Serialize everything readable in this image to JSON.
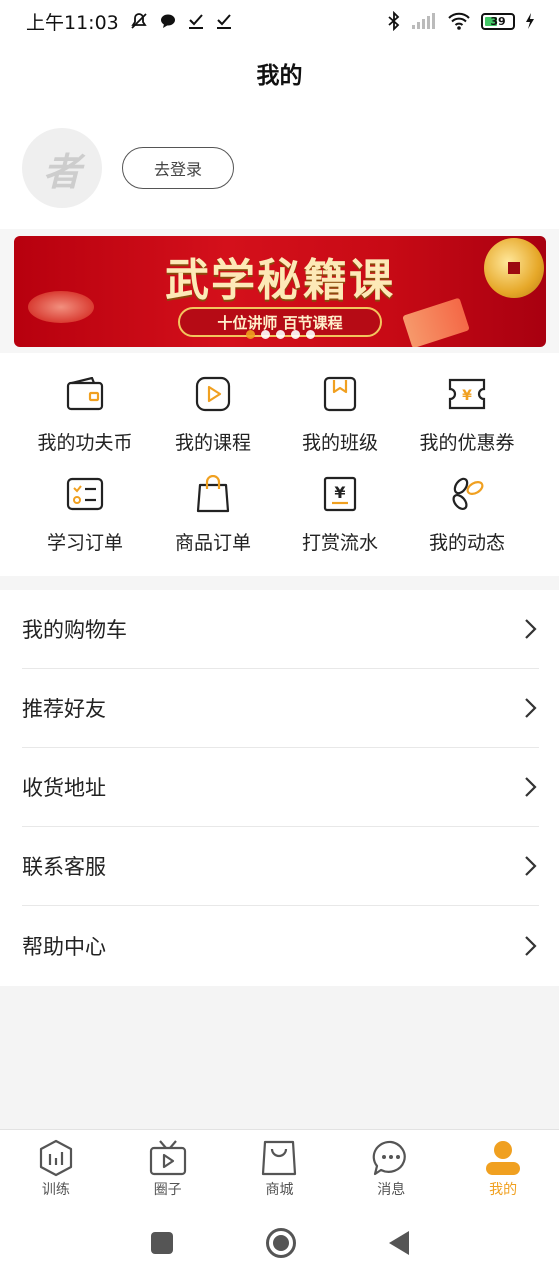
{
  "status_bar": {
    "time": "上午11:03",
    "battery": "39"
  },
  "header": {
    "title": "我的"
  },
  "profile": {
    "avatar_char": "者",
    "login_label": "去登录"
  },
  "banner": {
    "title": "武学秘籍课",
    "subtitle": "十位讲师 百节课程"
  },
  "grid": [
    {
      "label": "我的功夫币",
      "icon": "wallet-icon"
    },
    {
      "label": "我的课程",
      "icon": "play-course-icon"
    },
    {
      "label": "我的班级",
      "icon": "bookmark-class-icon"
    },
    {
      "label": "我的优惠券",
      "icon": "coupon-icon"
    },
    {
      "label": "学习订单",
      "icon": "study-order-icon"
    },
    {
      "label": "商品订单",
      "icon": "shopping-bag-icon"
    },
    {
      "label": "打赏流水",
      "icon": "reward-record-icon"
    },
    {
      "label": "我的动态",
      "icon": "feeds-icon"
    }
  ],
  "menu": [
    {
      "label": "我的购物车"
    },
    {
      "label": "推荐好友"
    },
    {
      "label": "收货地址"
    },
    {
      "label": "联系客服"
    },
    {
      "label": "帮助中心"
    }
  ],
  "tabs": [
    {
      "label": "训练",
      "icon": "training-icon"
    },
    {
      "label": "圈子",
      "icon": "tv-circle-icon"
    },
    {
      "label": "商城",
      "icon": "mall-bag-icon"
    },
    {
      "label": "消息",
      "icon": "message-icon"
    },
    {
      "label": "我的",
      "icon": "profile-icon",
      "active": true
    }
  ],
  "colors": {
    "accent": "#f0a020",
    "banner_red": "#c80a15"
  }
}
